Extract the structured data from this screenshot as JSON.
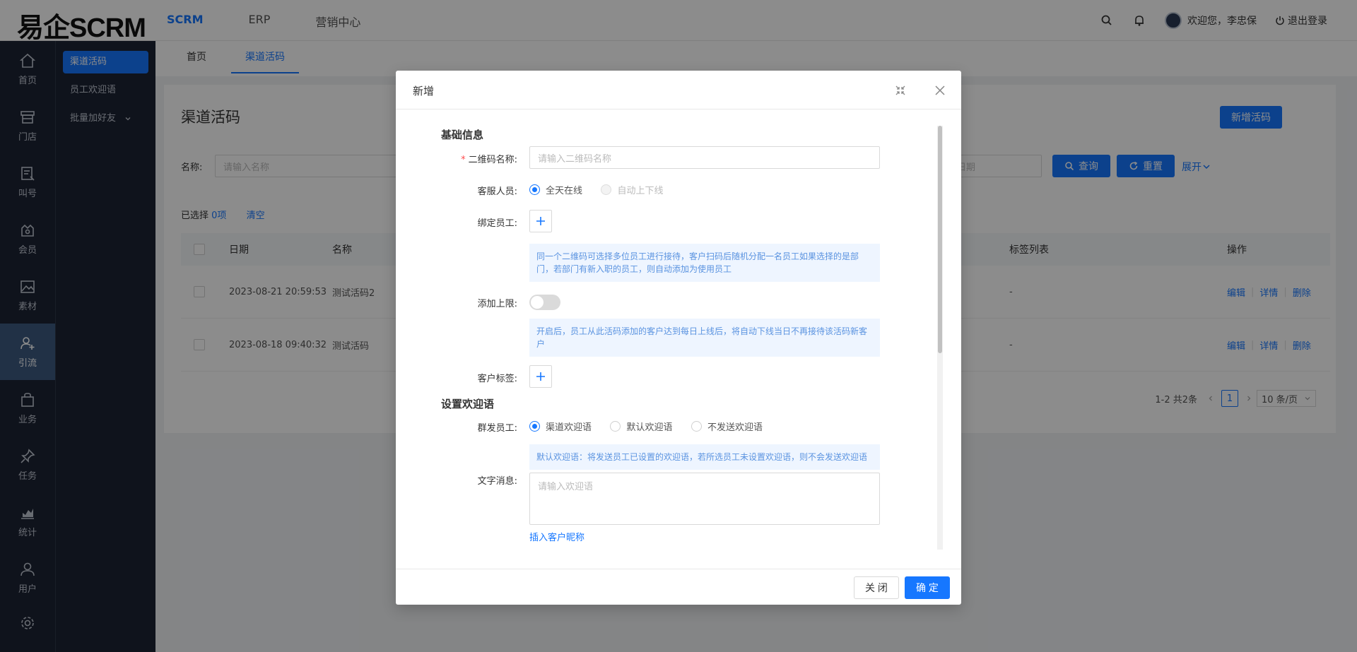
{
  "brand": {
    "logo": "易企SCRM"
  },
  "topnav": [
    {
      "label": "SCRM",
      "active": true
    },
    {
      "label": "ERP",
      "active": false
    },
    {
      "label": "营销中心",
      "active": false
    }
  ],
  "user": {
    "greeting": "欢迎您，李忠保",
    "logout": "退出登录"
  },
  "sidebar": [
    {
      "label": "首页",
      "icon": "home-icon"
    },
    {
      "label": "门店",
      "icon": "store-icon"
    },
    {
      "label": "叫号",
      "icon": "ticket-icon"
    },
    {
      "label": "会员",
      "icon": "member-icon"
    },
    {
      "label": "素材",
      "icon": "image-icon"
    },
    {
      "label": "引流",
      "icon": "traffic-icon",
      "active": true
    },
    {
      "label": "业务",
      "icon": "bag-icon"
    },
    {
      "label": "任务",
      "icon": "pin-icon"
    },
    {
      "label": "统计",
      "icon": "chart-icon"
    },
    {
      "label": "用户",
      "icon": "user-icon"
    }
  ],
  "subnav": [
    {
      "label": "渠道活码",
      "active": true
    },
    {
      "label": "员工欢迎语"
    },
    {
      "label": "批量加好友"
    }
  ],
  "tabs": [
    {
      "label": "首页"
    },
    {
      "label": "渠道活码",
      "active": true
    }
  ],
  "page": {
    "title": "渠道活码",
    "new_button": "新增活码",
    "filter_name_label": "名称:",
    "filter_name_placeholder": "请输入名称",
    "filter_date_placeholder": "日期",
    "query_button": "查询",
    "reset_button": "重置",
    "expand_link": "展开",
    "selected_prefix": "已选择 ",
    "selected_count": "0项",
    "clear_link": "清空",
    "columns": {
      "date": "日期",
      "name": "名称",
      "tags": "标签列表",
      "actions": "操作"
    },
    "rows": [
      {
        "date": "2023-08-21 20:59:53",
        "name": "测试活码2",
        "tags": "-",
        "edit": "编辑",
        "detail": "详情",
        "delete": "删除"
      },
      {
        "date": "2023-08-18 09:40:32",
        "name": "测试活码",
        "tags": "-",
        "edit": "编辑",
        "detail": "详情",
        "delete": "删除"
      }
    ],
    "pagination": {
      "total": "1-2 共2条",
      "current": "1",
      "page_size": "10 条/页"
    }
  },
  "modal": {
    "title": "新增",
    "basic_section": "基础信息",
    "qr_name_label": "二维码名称:",
    "qr_name_placeholder": "请输入二维码名称",
    "service_label": "客服人员:",
    "service_options": [
      "全天在线",
      "自动上下线"
    ],
    "bind_staff_label": "绑定员工:",
    "bind_tip": "同一个二维码可选择多位员工进行接待，客户扫码后随机分配一名员工如果选择的是部门，若部门有新入职的员工，则自动添加为使用员工",
    "limit_label": "添加上限:",
    "limit_tip": "开启后，员工从此活码添加的客户达到每日上线后，将自动下线当日不再接待该活码新客户",
    "customer_tag_label": "客户标签:",
    "welcome_section": "设置欢迎语",
    "mass_staff_label": "群发员工:",
    "welcome_options": [
      "渠道欢迎语",
      "默认欢迎语",
      "不发送欢迎语"
    ],
    "welcome_tip": "默认欢迎语：将发送员工已设置的欢迎语，若所选员工未设置欢迎语，则不会发送欢迎语",
    "text_msg_label": "文字消息:",
    "text_msg_placeholder": "请输入欢迎语",
    "insert_nickname": "插入客户昵称",
    "close_button": "关 闭",
    "ok_button": "确 定"
  }
}
